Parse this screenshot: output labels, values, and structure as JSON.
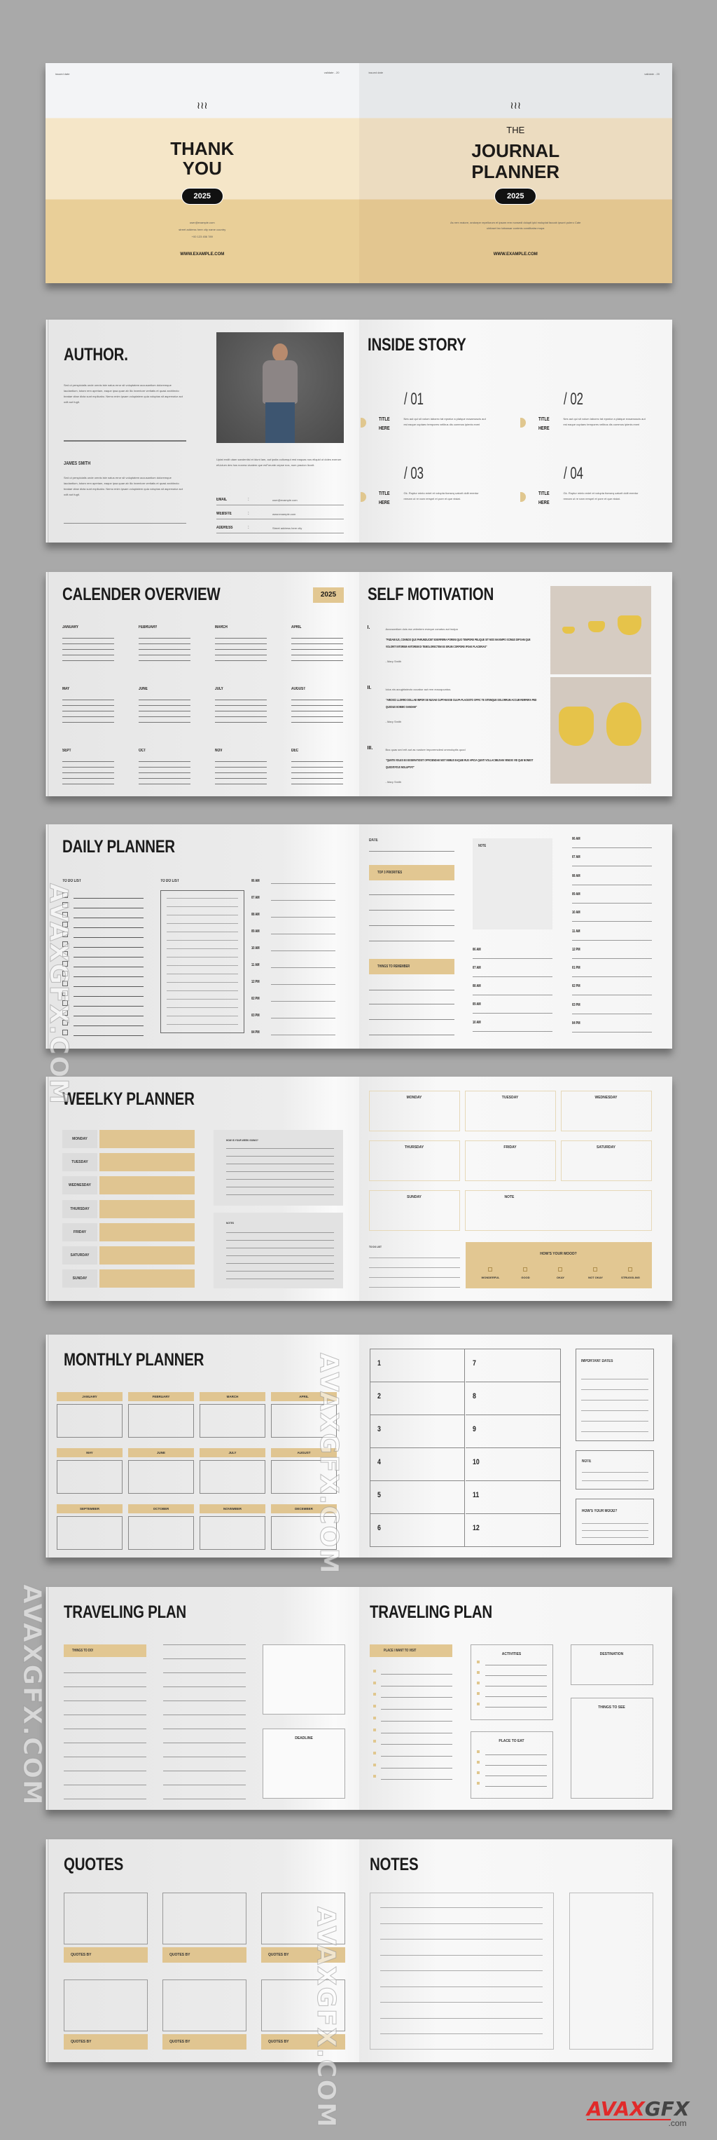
{
  "cover": {
    "left": {
      "issued_label": "issued date",
      "validate_label": "validate - 20",
      "title_line1": "THANK",
      "title_line2": "YOU",
      "year": "2025",
      "email": "user@example.com",
      "address": "street address here city name country",
      "phone": "+00 123 456 789",
      "website": "WWW.EXAMPLE.COM"
    },
    "right": {
      "issued_label": "issued date",
      "validate_label": "validate - 20",
      "pretitle": "THE",
      "title_line1": "JOURNAL",
      "title_line2": "PLANNER",
      "year": "2025",
      "blurb": "As rem maiore, andoepe repellorum et ipsam rem nonsedi dolupti ipid moluptat faccab ipsunt pulero Cate ubiloset inc tabussar contmis condlbatra mupa",
      "website": "WWW.EXAMPLE.COM"
    },
    "logo_icon": "steam-waves-icon"
  },
  "author": {
    "title": "AUTHOR.",
    "intro": "Sed ut perspiciatis unde omnis iste natus error sit voluptatem accusantium doloremque laudantium, totam rem aperiam, eaque ipsa quae ab illo inventore veritatis et quasi architecto beatae vitae dicta sunt explicabo. Nemo enim ipsam voluptatem quia voluptas sit aspernatur aut odit aut fugit.",
    "name": "JAMES SMITH",
    "bio": "Sed ut perspiciatis unde omnis iste natus error sit voluptatem accusantium doloremque laudantium, totam rem aperiam, eaque ipsa quae ab illo inventore veritatis et quasi architecto beatae vitae dicta sunt explicabo. Nemo enim ipsam voluptatem quia voluptas sit aspernatur aut odit aut fugit.",
    "photo_caption": "Uptat endit utam sandentisl et idunt lam, aut ipsita cullumqui rest eaquas nos eliquid ut doles exerum etUctum des hos noxera vicatem que esForunte cepse nos, num pracion licorit.",
    "contacts": [
      {
        "label": "EMAIL",
        "sep": ":",
        "value": "user@example.com"
      },
      {
        "label": "WEBSITE",
        "sep": ":",
        "value": "www.example.com"
      },
      {
        "label": "ADDRESS",
        "sep": ":",
        "value": "Street address here city"
      }
    ]
  },
  "inside_story": {
    "title": "INSIDE STORY",
    "items": [
      {
        "num": "/ 01",
        "title1": "TITLE",
        "title2": "HERE",
        "text": "Nes aut qui sit volum laborec tat epratur a platque eosamuscis aut est eaque cuptaec tempores velibus dis commos ipienis exeri"
      },
      {
        "num": "/ 02",
        "title1": "TITLE",
        "title2": "HERE",
        "text": "Nes aut qui sit volum laborec tat epratur a platque eosamuscis aut est eaque cuptaec tempores velibus dis commos ipienis exeri"
      },
      {
        "num": "/ 03",
        "title1": "TITLE",
        "title2": "HERE",
        "text": "Gk. Ruptur minto eniet et volupta tionseq uaturit dolit erentur remam ut re nam rerspel et pore et que nistat."
      },
      {
        "num": "/ 04",
        "title1": "TITLE",
        "title2": "HERE",
        "text": "Gk. Ruptur minto eniet et volupta tionseq uaturit dolit erentur remam ut re nam rerspel et pore et que nistat."
      }
    ]
  },
  "calendar": {
    "title": "CALENDER OVERVIEW",
    "year": "2025",
    "months": [
      "JANUARY",
      "FEBRUARY",
      "MARCH",
      "APRIL",
      "MAY",
      "JUNE",
      "JULY",
      "AUGUST",
      "SEPT",
      "OCT",
      "NOV",
      "DEC"
    ]
  },
  "motivation": {
    "title": "SELF MOTIVATION",
    "items": [
      {
        "num": "I.",
        "intro": "Accusantium dois ma velentem eveque conatus aut inulpa",
        "quote": "\"PUDAM IUS, CONNOD QUS PARUNDUCIET EXERFERIA PORENI QUO TEMPORE PELIQUE SIT MOS MAXIMPO SCIMUS DIPSAM QUE VOLORIT INTOREM ANTOREM DI TEMOLORECTEM EX ERUM CORPORE IPSAE PLACERIAS\"",
        "author": "- Mary Smith"
      },
      {
        "num": "II.",
        "intro": "Iclus nis aoughtatecto occabor aut rem eosoquuntus.",
        "quote": "\"ARIOSCI LLORRO DOLLAB IMPOR SE NUSAE CUPTAM ESE CULPA PLACESTO OFFIC TE SITEMQUE DOLORRUM ACCUM RERFERA PED QUODUS EOMMO SANDAM\"",
        "author": "- Mary Smith"
      },
      {
        "num": "III.",
        "intro": "Bus quas sed erit aut as nustore imporemolest ommoluptis quod",
        "quote": "\"QUNTE VOLES EX EXSERATIOSIT OFFICIENDAE NIST INIMUS EAQUIE RUS APICIA QUNTI VOLLACIMUSAM VENDIS VID QUE NONEST QUODITATUS MOLUPTAT\"",
        "author": "- Mary Smith"
      }
    ]
  },
  "daily": {
    "title": "DAILY PLANNER",
    "todo_label_1": "TO DO LIST",
    "todo_label_2": "TO DO LIST",
    "times_left": [
      "06 AM",
      "07 AM",
      "08 AM",
      "09 AM",
      "10 AM",
      "11 AM",
      "12 PM",
      "02 PM",
      "03 PM",
      "04 PM"
    ],
    "date_label": "DATE",
    "priorities_label": "TOP 3 PRIORITIES",
    "remember_label": "THINGS TO REMEMBER",
    "note_label": "NOTE",
    "times_mid": [
      "06 AM",
      "07 AM",
      "08 AM",
      "09 AM",
      "10 AM"
    ],
    "times_right": [
      "06 AM",
      "07 AM",
      "08 AM",
      "09 AM",
      "10 AM",
      "11 AM",
      "12 PM",
      "01 PM",
      "02 PM",
      "03 PM",
      "04 PM"
    ]
  },
  "weekly": {
    "title": "WEELKY PLANNER",
    "days": [
      "MONDAY",
      "TUESDAY",
      "WEDNESDAY",
      "THURSDAY",
      "FRIDAY",
      "SATURDAY",
      "SUNDAY"
    ],
    "week_going_label": "HOW IS YOUR WEEK GOING?",
    "notes_label": "NOTES",
    "grid": [
      "MONDAY",
      "TUESDAY",
      "WEDNESDAY",
      "THURSDAY",
      "FRIDAY",
      "SATURDAY",
      "SUNDAY",
      "NOTE"
    ],
    "todo_label": "TO DO LIST",
    "mood_title": "HOW'S YOUR MOOD?",
    "moods": [
      "WONDERFUL",
      "GOOD",
      "OKAY",
      "NOT OKAY",
      "STRUGGLING"
    ]
  },
  "monthly": {
    "title": "MONTHLY PLANNER",
    "months": [
      "JANUARY",
      "FEBRUARY",
      "MARCH",
      "APRIL",
      "MAY",
      "JUNE",
      "JULY",
      "AUGUST",
      "SEPTEMBER",
      "OCTOBER",
      "NOVEMBER",
      "DECEMBER"
    ],
    "numbers": [
      "1",
      "7",
      "2",
      "8",
      "3",
      "9",
      "4",
      "10",
      "5",
      "11",
      "6",
      "12"
    ],
    "important_label": "IMPORTANT DATES",
    "note_label": "NOTE",
    "mood_label": "HOW'S YOUR MOOD?"
  },
  "travel": {
    "title_left": "TRAVELING PLAN",
    "things_todo": "THINGS TO DO!",
    "deadline": "DEADLINE",
    "title_right": "TRAVELING PLAN",
    "visit_label": "PLACE I WANT TO VISIT",
    "activities_label": "ACTIVITIES",
    "eat_label": "PLACE TO EAT",
    "destination_label": "DESTINATION",
    "see_label": "THINGS TO SEE"
  },
  "quotes": {
    "title": "QUOTES",
    "by_labels": [
      "QUOTES BY",
      "QUOTES BY",
      "QUOTES BY",
      "QUOTES BY",
      "QUOTES BY",
      "QUOTES BY"
    ]
  },
  "notes": {
    "title": "NOTES"
  },
  "watermark": {
    "text": "AVAXGFX.COM",
    "logo_main": "AVAXGFX",
    "logo_sub": ".com",
    "accent": "#e02a2a"
  },
  "colors": {
    "gold": "#e2c792",
    "cream": "#f5e6c8",
    "dark": "#1b1b1b"
  }
}
